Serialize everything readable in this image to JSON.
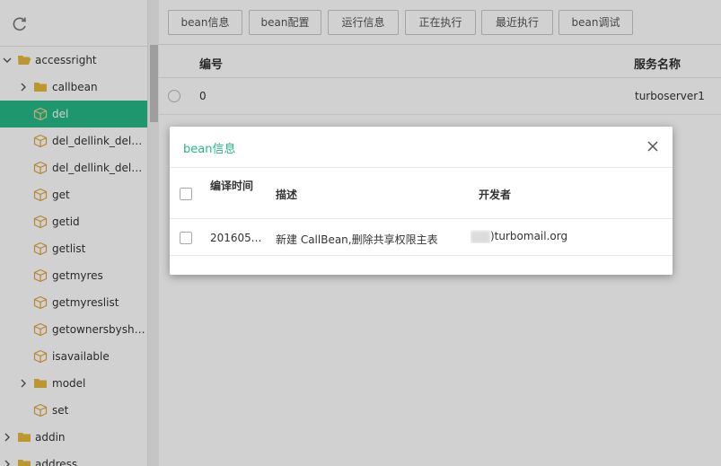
{
  "sidebar": {
    "tree": [
      {
        "label": "accessright",
        "type": "folder",
        "expanded": true
      },
      {
        "label": "callbean",
        "type": "folder",
        "expanded": false
      },
      {
        "label": "del",
        "type": "bean",
        "selected": true
      },
      {
        "label": "del_dellink_del_d...",
        "type": "bean"
      },
      {
        "label": "del_dellink_del_...",
        "type": "bean"
      },
      {
        "label": "get",
        "type": "bean"
      },
      {
        "label": "getid",
        "type": "bean"
      },
      {
        "label": "getlist",
        "type": "bean"
      },
      {
        "label": "getmyres",
        "type": "bean"
      },
      {
        "label": "getmyreslist",
        "type": "bean"
      },
      {
        "label": "getownersbyshar...",
        "type": "bean"
      },
      {
        "label": "isavailable",
        "type": "bean"
      },
      {
        "label": "model",
        "type": "folder",
        "expanded": false
      },
      {
        "label": "set",
        "type": "bean"
      },
      {
        "label": "addin",
        "type": "folder",
        "expanded": false
      },
      {
        "label": "address",
        "type": "folder",
        "expanded": false
      }
    ]
  },
  "toolbar": {
    "buttons": [
      "bean信息",
      "bean配置",
      "运行信息",
      "正在执行",
      "最近执行",
      "bean调试"
    ]
  },
  "table": {
    "headers": {
      "id": "编号",
      "service": "服务名称"
    },
    "rows": [
      {
        "id": "0",
        "service": "turboserver1"
      }
    ]
  },
  "modal": {
    "title": "bean信息",
    "headers": {
      "compile_time": "编译时间",
      "description": "描述",
      "developer": "开发者"
    },
    "rows": [
      {
        "compile_time": "201605...",
        "description": "新建 CallBean,删除共享权限主表",
        "developer": ")turbomail.org"
      }
    ]
  },
  "colors": {
    "accent": "#25b887",
    "folder": "#e6b93b",
    "bean_icon": "#d9a640"
  }
}
